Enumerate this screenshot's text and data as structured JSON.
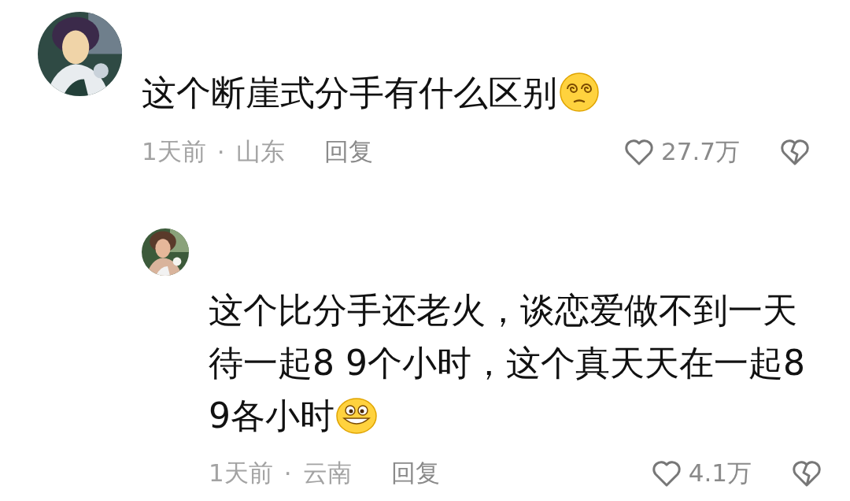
{
  "comments": [
    {
      "kind": "comment",
      "text": "这个断崖式分手有什么区别",
      "emoji": {
        "kind": "dizzy"
      },
      "time": "1天前",
      "separator": "·",
      "location": "山东",
      "reply": "回复",
      "likes": "27.7万"
    },
    {
      "kind": "reply",
      "text": "这个比分手还老火，谈恋爱做不到一天待一起8 9个小时，这个真天天在一起8 9各小时",
      "emoji": {
        "kind": "grin"
      },
      "time": "1天前",
      "separator": "·",
      "location": "云南",
      "reply": "回复",
      "likes": "4.1万"
    }
  ]
}
